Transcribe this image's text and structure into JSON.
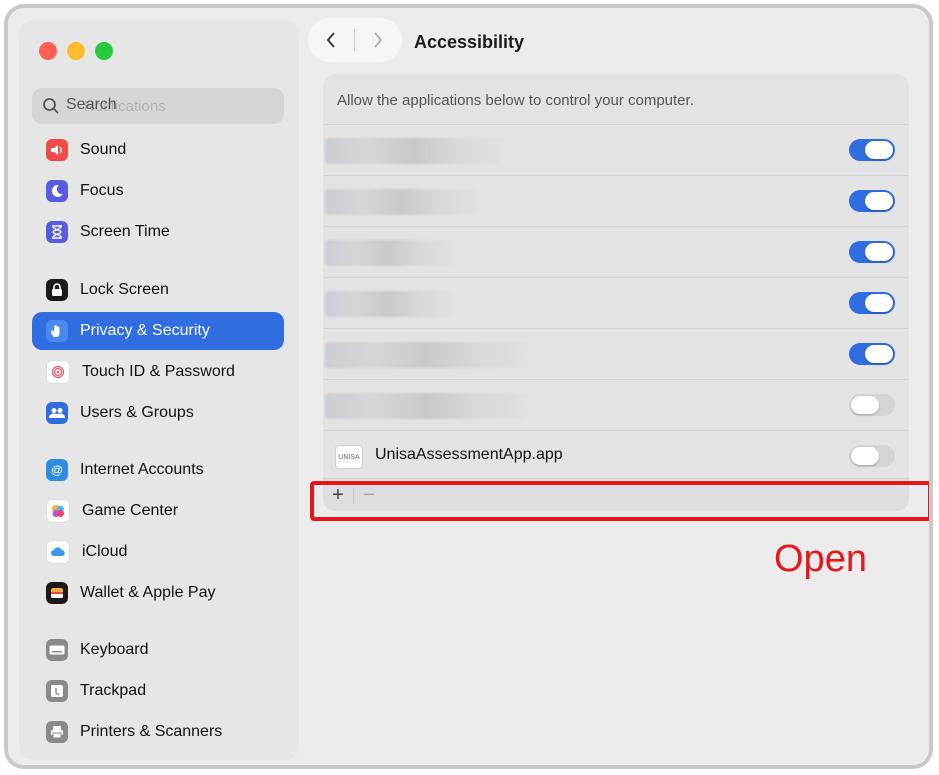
{
  "sidebar": {
    "search_placeholder": "Search",
    "search_ghost_text": "Notifications",
    "items": [
      {
        "label": "Sound",
        "icon": "speaker-icon",
        "color": "#f14a4a"
      },
      {
        "label": "Focus",
        "icon": "moon-icon",
        "color": "#5b5be0"
      },
      {
        "label": "Screen Time",
        "icon": "hourglass-icon",
        "color": "#5b5be0"
      },
      {
        "label": "Lock Screen",
        "icon": "lock-icon",
        "color": "#1a1a1a"
      },
      {
        "label": "Privacy & Security",
        "icon": "hand-icon",
        "color": "#2f6de1",
        "active": true
      },
      {
        "label": "Touch ID & Password",
        "icon": "fingerprint-icon",
        "color": "#ffffff"
      },
      {
        "label": "Users & Groups",
        "icon": "users-icon",
        "color": "#2f6de1"
      },
      {
        "label": "Internet Accounts",
        "icon": "at-icon",
        "color": "#2f8de1"
      },
      {
        "label": "Game Center",
        "icon": "game-center-icon",
        "color": "#ffffff"
      },
      {
        "label": "iCloud",
        "icon": "cloud-icon",
        "color": "#ffffff"
      },
      {
        "label": "Wallet & Apple Pay",
        "icon": "wallet-icon",
        "color": "#1a1a1a"
      },
      {
        "label": "Keyboard",
        "icon": "keyboard-icon",
        "color": "#8a8a8a"
      },
      {
        "label": "Trackpad",
        "icon": "trackpad-icon",
        "color": "#8a8a8a"
      },
      {
        "label": "Printers & Scanners",
        "icon": "printer-icon",
        "color": "#8a8a8a"
      }
    ]
  },
  "header": {
    "title": "Accessibility"
  },
  "panel": {
    "description": "Allow the applications below to control your computer.",
    "apps": [
      {
        "name": "",
        "enabled": true
      },
      {
        "name": "",
        "enabled": true
      },
      {
        "name": "",
        "enabled": true
      },
      {
        "name": "",
        "enabled": true
      },
      {
        "name": "",
        "enabled": true
      },
      {
        "name": "",
        "enabled": false
      },
      {
        "name": "UnisaAssessmentApp.app",
        "icon_text": "UNISA",
        "enabled": false
      }
    ],
    "add_label": "+",
    "remove_label": "−"
  },
  "annotation": {
    "text": "Open",
    "color": "#e8161b"
  },
  "colors": {
    "accent": "#2f6de1"
  }
}
